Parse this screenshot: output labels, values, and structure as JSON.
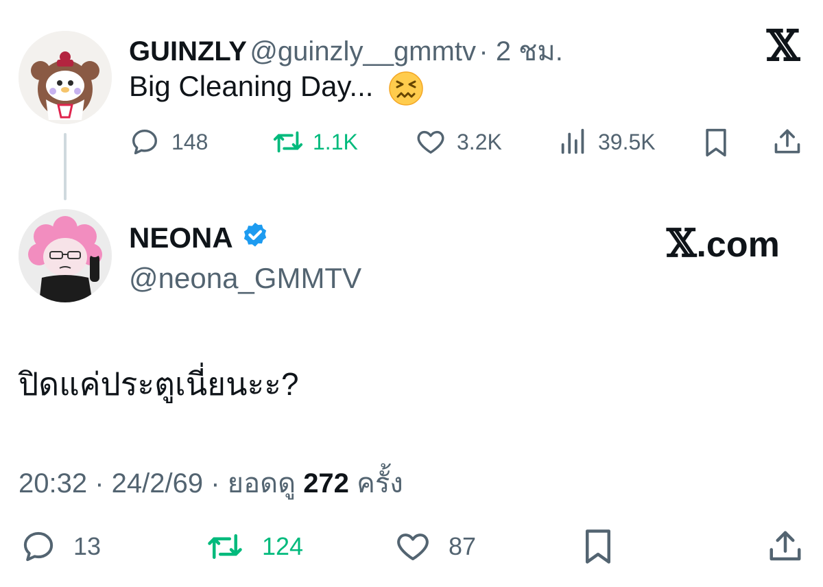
{
  "parent_post": {
    "author_name": "GUINZLY",
    "author_handle": "@guinzly__gmmtv",
    "time_ago": "· 2 ชม.",
    "text": "Big Cleaning Day...",
    "emoji": "confounded-face-emoji",
    "stats": {
      "replies": "148",
      "reposts": "1.1K",
      "likes": "3.2K",
      "views": "39.5K"
    }
  },
  "reply_post": {
    "author_name": "NEONA",
    "verified": true,
    "author_handle": "@neona_GMMTV",
    "text": "ปิดแค่ประตูเนี่ยนะะ?",
    "timestamp": "20:32 · 24/2/69 · ยอดดู",
    "view_count": "272",
    "view_suffix": "ครั้ง",
    "stats": {
      "replies": "13",
      "reposts": "124",
      "likes": "87"
    }
  },
  "branding": {
    "logo_letter": "𝕏",
    "watermark_letter": "𝕏",
    "watermark_suffix": ".com"
  },
  "colors": {
    "text": "#0f1419",
    "secondary": "#536471",
    "repost_green": "#00ba7c",
    "verified_blue": "#1d9bf0"
  }
}
